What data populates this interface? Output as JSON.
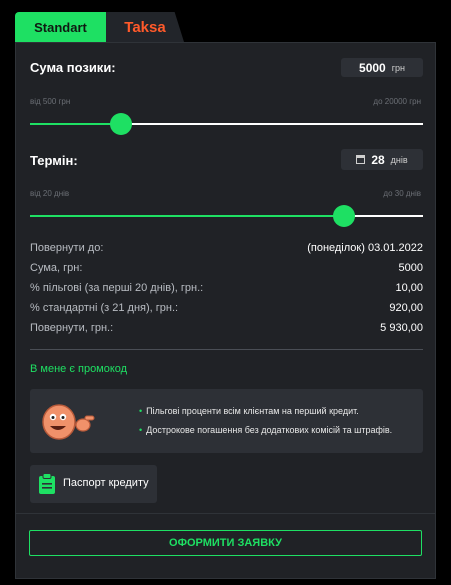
{
  "tabs": [
    {
      "label": "Standart"
    },
    {
      "label": "Taksa"
    }
  ],
  "loan": {
    "label": "Сума позики:",
    "value": "5000",
    "unit": "грн",
    "min_label": "від 500 грн",
    "max_label": "до 20000 грн",
    "min": 500,
    "max": 20000,
    "current": 5000
  },
  "term": {
    "label": "Термін:",
    "value": "28",
    "unit": "днів",
    "min_label": "від 20 днів",
    "max_label": "до 30 днів",
    "min": 20,
    "max": 30,
    "current": 28
  },
  "summary": [
    {
      "label": "Повернути до:",
      "value": "(понеділок) 03.01.2022"
    },
    {
      "label": "Сума, грн:",
      "value": "5000"
    },
    {
      "label": "% пільгові (за перші 20 днів), грн.:",
      "value": "10,00"
    },
    {
      "label": "% стандартні (з 21 дня), грн.:",
      "value": "920,00"
    },
    {
      "label": "Повернути, грн.:",
      "value": "5 930,00"
    }
  ],
  "promo_label": "В мене є промокод",
  "benefits": [
    "Пільгові проценти всім клієнтам на перший кредит.",
    "Дострокове погашення без додаткових комісій та штрафів."
  ],
  "passport_label": "Паспорт кредиту",
  "submit_label": "ОФОРМИТИ ЗАЯВКУ",
  "colors": {
    "accent": "#1ee063",
    "brand_orange": "#ff5a2a",
    "panel": "#202226"
  }
}
